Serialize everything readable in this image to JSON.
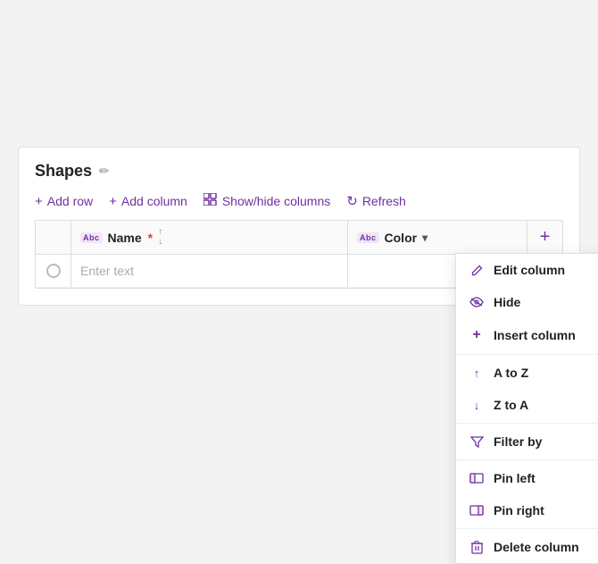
{
  "title": "Shapes",
  "toolbar": {
    "add_row": "Add row",
    "add_column": "Add column",
    "show_hide_columns": "Show/hide columns",
    "refresh": "Refresh"
  },
  "table": {
    "columns": [
      {
        "label": "Name",
        "required": true
      },
      {
        "label": "Color"
      }
    ],
    "row": {
      "name_placeholder": "Enter text"
    },
    "add_column_tooltip": "+"
  },
  "dropdown": {
    "items": [
      {
        "icon": "edit",
        "label": "Edit column"
      },
      {
        "icon": "hide",
        "label": "Hide"
      },
      {
        "icon": "insert",
        "label": "Insert column"
      },
      {
        "icon": "atoz",
        "label": "A to Z"
      },
      {
        "icon": "ztoa",
        "label": "Z to A"
      },
      {
        "icon": "filter",
        "label": "Filter by"
      },
      {
        "icon": "pinleft",
        "label": "Pin left"
      },
      {
        "icon": "pinright",
        "label": "Pin right"
      },
      {
        "icon": "delete",
        "label": "Delete column"
      }
    ]
  }
}
